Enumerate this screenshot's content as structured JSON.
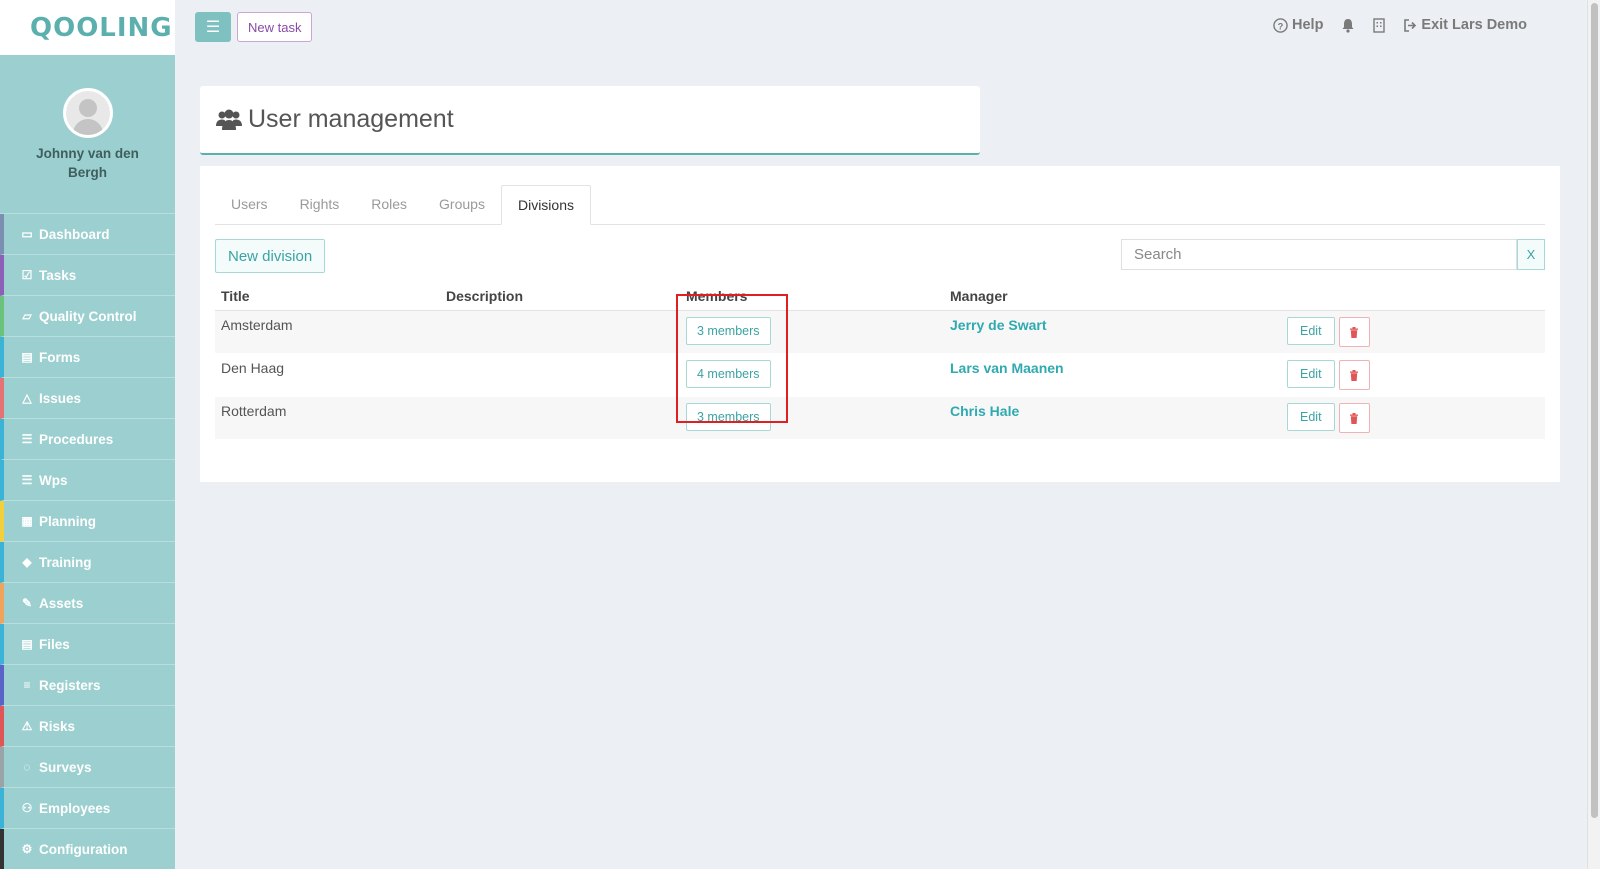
{
  "app": {
    "logo": "QOOLING"
  },
  "profile": {
    "name": "Johnny van den Bergh"
  },
  "sidebar": {
    "items": [
      {
        "label": "Dashboard",
        "icon": "monitor-icon",
        "glyph": "▭",
        "color": "#7b8fb0"
      },
      {
        "label": "Tasks",
        "icon": "check-square-icon",
        "glyph": "☑",
        "color": "#8e5fb8"
      },
      {
        "label": "Quality Control",
        "icon": "book-icon",
        "glyph": "▱",
        "color": "#6bc27a"
      },
      {
        "label": "Forms",
        "icon": "file-icon",
        "glyph": "▤",
        "color": "#3ab3d6"
      },
      {
        "label": "Issues",
        "icon": "bell-icon",
        "glyph": "△",
        "color": "#e57373"
      },
      {
        "label": "Procedures",
        "icon": "list-icon",
        "glyph": "☰",
        "color": "#3ab3d6"
      },
      {
        "label": "Wps",
        "icon": "list-alt-icon",
        "glyph": "☰",
        "color": "#3ab3d6"
      },
      {
        "label": "Planning",
        "icon": "calendar-icon",
        "glyph": "▦",
        "color": "#f2cf3c"
      },
      {
        "label": "Training",
        "icon": "graduation-cap-icon",
        "glyph": "◆",
        "color": "#3ab3d6"
      },
      {
        "label": "Assets",
        "icon": "wrench-icon",
        "glyph": "✎",
        "color": "#f0a35a"
      },
      {
        "label": "Files",
        "icon": "file-alt-icon",
        "glyph": "▤",
        "color": "#3ab3d6"
      },
      {
        "label": "Registers",
        "icon": "registers-icon",
        "glyph": "≡",
        "color": "#5b63c9"
      },
      {
        "label": "Risks",
        "icon": "warning-icon",
        "glyph": "⚠",
        "color": "#e05555"
      },
      {
        "label": "Surveys",
        "icon": "comment-icon",
        "glyph": "◌",
        "color": "#9aa3a8"
      },
      {
        "label": "Employees",
        "icon": "users-icon",
        "glyph": "⚇",
        "color": "#3ab3d6"
      },
      {
        "label": "Configuration",
        "icon": "gear-icon",
        "glyph": "⚙",
        "color": "#333333"
      }
    ]
  },
  "topbar": {
    "new_task": "New task",
    "help": "Help",
    "exit": "Exit Lars Demo"
  },
  "page": {
    "title": "User management"
  },
  "tabs": [
    {
      "label": "Users",
      "active": false
    },
    {
      "label": "Rights",
      "active": false
    },
    {
      "label": "Roles",
      "active": false
    },
    {
      "label": "Groups",
      "active": false
    },
    {
      "label": "Divisions",
      "active": true
    }
  ],
  "toolbar": {
    "new_division": "New division",
    "search_placeholder": "Search",
    "clear": "X"
  },
  "table": {
    "headers": [
      "Title",
      "Description",
      "Members",
      "Manager"
    ],
    "rows": [
      {
        "title": "Amsterdam",
        "description": "",
        "members": "3 members",
        "manager": "Jerry de Swart"
      },
      {
        "title": "Den Haag",
        "description": "",
        "members": "4 members",
        "manager": "Lars van Maanen"
      },
      {
        "title": "Rotterdam",
        "description": "",
        "members": "3 members",
        "manager": "Chris Hale"
      }
    ],
    "edit_label": "Edit"
  },
  "colors": {
    "accent": "#5bb0ae",
    "sidebar": "#9ccfcf",
    "highlight": "#e02020"
  }
}
